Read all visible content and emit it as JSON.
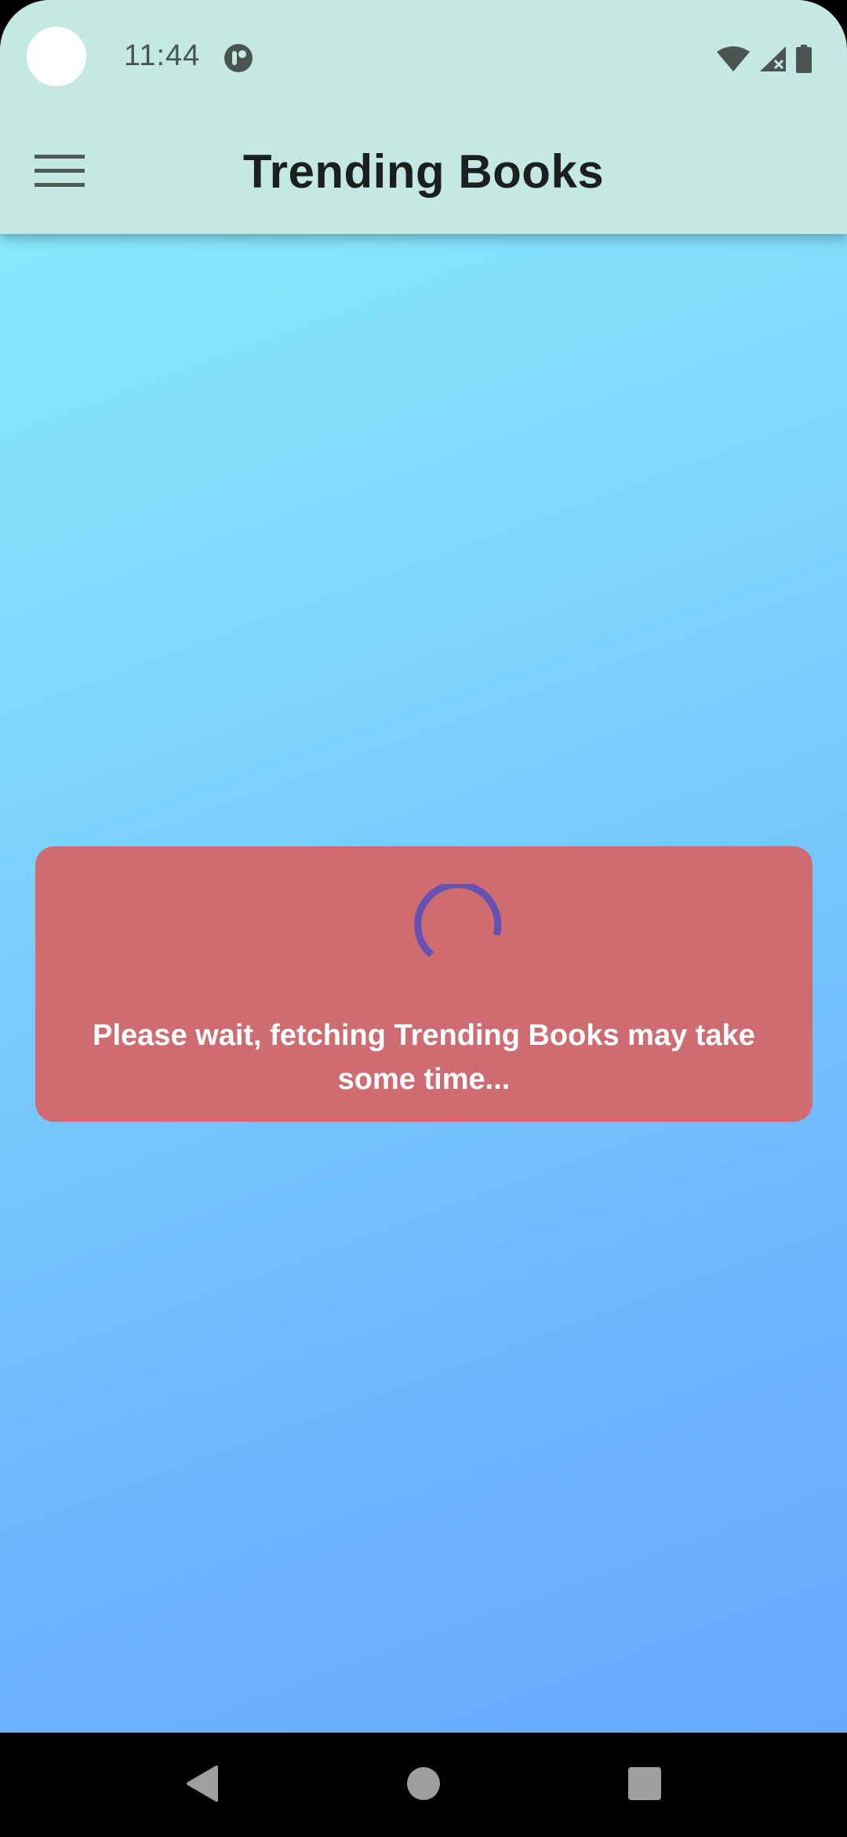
{
  "status_bar": {
    "time": "11:44",
    "icons": [
      "app-notification-icon",
      "wifi-icon",
      "signal-icon",
      "battery-icon"
    ]
  },
  "app_bar": {
    "title": "Trending Books",
    "menu_icon": "hamburger-menu-icon"
  },
  "loading_card": {
    "message": "Please wait, fetching Trending Books may take some time...",
    "spinner_color": "#6451b2",
    "background_color": "#cf6c71"
  },
  "nav_bar": {
    "buttons": [
      "back-icon",
      "home-icon",
      "recents-icon"
    ]
  },
  "colors": {
    "app_bar": "#c4e9e3",
    "gradient_start": "#8cf1fa",
    "gradient_end": "#67a6ff"
  }
}
